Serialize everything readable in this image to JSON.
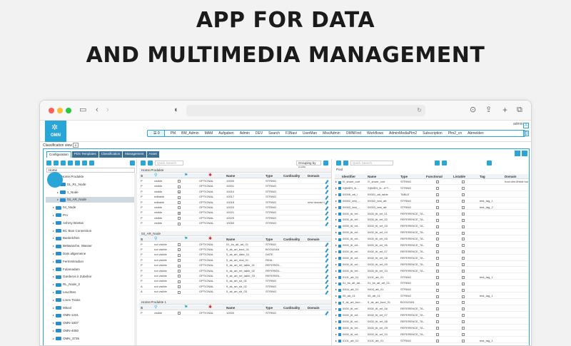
{
  "headline": {
    "line1": "APP FOR DATA",
    "line2": "AND MULTIMEDIA MANAGEMENT"
  },
  "app": {
    "logo": "OMN",
    "menu": [
      "PM",
      "BM_Admin",
      "MAM",
      "Aufgaben",
      "Admin",
      "DEV",
      "Search",
      "F3Navi",
      "UserMan",
      "MiscAdmin",
      "OMNFind",
      "Workflows",
      "AdminMediaPlm2",
      "Subscription",
      "Plm2_cn",
      "Abmelden"
    ],
    "user": "admin",
    "window_label": "Classification view",
    "module_tabs": [
      "Configuration",
      "PDS Templates",
      "Classification",
      "Management",
      "Asset"
    ],
    "active_tab": 0
  },
  "left": {
    "search_value": "Home",
    "tree": [
      "Home.Produkte",
      "01_RL_Node",
      "1_Node",
      "03_AR_Node",
      "04_Node",
      "Pro",
      "Ashrsy Brietas",
      "BC Bios Connection",
      "Bankelchen",
      "Bettwasche, Wasser",
      "Dats allgemeine",
      "Fermmitradion",
      "Fulamadam",
      "Garderos ir Zubehor",
      "RL_Node_2",
      "Leuchtes",
      "Lmes Trains",
      "Mitool",
      "OMN-1241",
      "OMN-1837",
      "OMN-4050",
      "OMN_3735"
    ]
  },
  "middle": {
    "search_placeholder": "Quick Search",
    "grouping": "Grouping by node",
    "section1": "Home.Produkte",
    "section2": "03_AR_Node",
    "section3": "Home.Produkte 1",
    "columns": [
      "S",
      "",
      "",
      "",
      "Name",
      "Type",
      "Cardinality",
      "Domain"
    ],
    "rows1": [
      [
        "P",
        "visible",
        "0",
        "OPTIONAL",
        "10000",
        "STRING",
        ""
      ],
      [
        "P",
        "visible",
        "0",
        "OPTIONAL",
        "10001",
        "STRING",
        ""
      ],
      [
        "P",
        "visible",
        "1",
        "OPTIONAL",
        "10010",
        "STRING",
        ""
      ],
      [
        "P",
        "editable",
        "0",
        "OPTIONAL",
        "10017",
        "STRING",
        ""
      ],
      [
        "P",
        "editable",
        "0",
        "OPTIONAL",
        "10018",
        "STRING",
        "new domain v..."
      ],
      [
        "P",
        "visible",
        "0",
        "OPTIONAL",
        "10020",
        "STRING",
        ""
      ],
      [
        "P",
        "visible",
        "1",
        "OPTIONAL",
        "10021",
        "STRING",
        ""
      ],
      [
        "P",
        "visible",
        "0",
        "OPTIONAL",
        "10029",
        "STRING",
        ""
      ],
      [
        "P",
        "visible",
        "0",
        "OPTIONAL",
        "10050",
        "STRING",
        ""
      ]
    ],
    "rows2": [
      [
        "P",
        "not visible",
        "0",
        "OPTIONAL",
        "01_bs_alt_art_01",
        "STRING"
      ],
      [
        "P",
        "not visible",
        "0",
        "OPTIONAL",
        "5_ak_art_bool_01",
        "BOOLEAN"
      ],
      [
        "P",
        "not visible",
        "0",
        "OPTIONAL",
        "5_ak_art_date_01",
        "DATE"
      ],
      [
        "P",
        "not visible",
        "0",
        "OPTIONAL",
        "5_ak_art_real_01",
        "REAL"
      ],
      [
        "P",
        "not visible",
        "0",
        "OPTIONAL",
        "5_ak_art_ref_table_01",
        "REFEREN..."
      ],
      [
        "P",
        "not visible",
        "0",
        "OPTIONAL",
        "5_ak_art_ref_table_02",
        "REFEREN..."
      ],
      [
        "P",
        "not visible",
        "0",
        "OPTIONAL",
        "5_ak_art_ref_table_03",
        "REFEREN..."
      ],
      [
        "P",
        "not visible",
        "0",
        "OPTIONAL",
        "5_ak_art_str_01",
        "STRING"
      ],
      [
        "A",
        "not visible",
        "0",
        "OPTIONAL",
        "5_ak_art_str_02",
        "STRING"
      ],
      [
        "A",
        "not visible",
        "0",
        "OPTIONAL",
        "5_ak_art_str_03",
        "STRING"
      ]
    ],
    "rows3": [
      [
        "P",
        "visible",
        "0",
        "OPTIONAL",
        "10000",
        "STRING"
      ]
    ]
  },
  "right": {
    "search_placeholder": "Quick Search",
    "pool_label": "Pool",
    "columns": [
      "Identifier",
      "Name",
      "Type",
      "Functional",
      "Listable",
      "Tag",
      "Domain"
    ],
    "rows": [
      [
        "!!!_shum_cort",
        "!!!_shum_cort",
        "STRING",
        "",
        "",
        "",
        "hoci:dmr.8htrdr.hoi"
      ],
      [
        "!!@#$%_ik...",
        "!!@#$%_ik...#^*!...",
        "STRING",
        "",
        "",
        "",
        ""
      ],
      [
        "00006_att_l",
        "00001_att_table",
        "TABLE",
        "",
        "",
        "",
        ""
      ],
      [
        "00002_test_...",
        "00002_test_att",
        "STRING",
        "",
        "",
        "test_tag_1",
        ""
      ],
      [
        "00003_test_...",
        "00003_test_att",
        "STRING",
        "",
        "",
        "test_tag_2",
        ""
      ],
      [
        "0000_ttl_ref...",
        "0000_ttl_ref_01",
        "REFERENCE_TA...",
        "",
        "",
        "",
        ""
      ],
      [
        "0000_ttl_ref...",
        "0000_ttl_ref_02",
        "REFERENCE_TA...",
        "",
        "",
        "",
        ""
      ],
      [
        "0000_ttl_ref...",
        "0000_ttl_ref_03",
        "REFERENCE_TA...",
        "",
        "",
        "",
        ""
      ],
      [
        "0000_ttl_ref...",
        "0000_ttl_ref_04",
        "REFERENCE_TA...",
        "",
        "",
        "",
        ""
      ],
      [
        "0000_ttl_ref...",
        "0000_ttl_ref_05",
        "REFERENCE_TA...",
        "",
        "",
        "",
        ""
      ],
      [
        "0000_ttl_ref...",
        "0000_ttl_ref_06",
        "REFERENCE_TA...",
        "",
        "",
        "",
        ""
      ],
      [
        "0000_ttl_ref...",
        "0000_ttl_ref_07",
        "REFERENCE_TA...",
        "",
        "",
        "",
        ""
      ],
      [
        "0000_ttl_ref...",
        "0000_ttl_ref_08",
        "REFERENCE_TA...",
        "",
        "",
        "",
        ""
      ],
      [
        "0000_ttl_ref...",
        "0000_ttl_ref_09",
        "REFERENCE_TA...",
        "",
        "",
        "",
        ""
      ],
      [
        "0000_ttl_ref...",
        "0000_ttl_ref_10",
        "REFERENCE_TA...",
        "",
        "",
        "",
        ""
      ],
      [
        "0101_att_01",
        "0101_att_01",
        "STRING",
        "",
        "",
        "test_tag_1",
        ""
      ],
      [
        "01_bs_alt_art...",
        "01_bs_alt_art_01",
        "STRING",
        "",
        "",
        "",
        ""
      ],
      [
        "0404_att_01",
        "0404_att_01",
        "STRING",
        "",
        "",
        "",
        ""
      ],
      [
        "05_att_01",
        "05_att_01",
        "STRING",
        "",
        "",
        "test_tag_1",
        ""
      ],
      [
        "5_ak_art_boo...",
        "5_ak_art_bool_01",
        "BOOLEAN",
        "",
        "",
        "",
        ""
      ],
      [
        "0000_ttl_ref...",
        "0000_ttl_ref_06",
        "REFERENCE_TA...",
        "",
        "",
        "",
        ""
      ],
      [
        "0000_ttl_ref...",
        "0000_ttl_ref_07",
        "REFERENCE_TA...",
        "",
        "",
        "",
        ""
      ],
      [
        "0000_ttl_ref...",
        "0000_ttl_ref_08",
        "REFERENCE_TA...",
        "",
        "",
        "",
        ""
      ],
      [
        "0000_ttl_ref...",
        "0000_ttl_ref_09",
        "REFERENCE_TA...",
        "",
        "",
        "",
        ""
      ],
      [
        "0000_ttl_ref...",
        "0000_ttl_ref_10",
        "REFERENCE_TA...",
        "",
        "",
        "",
        ""
      ],
      [
        "0101_att_01",
        "0101_att_01",
        "STRING",
        "",
        "",
        "test_tag_1",
        ""
      ]
    ]
  },
  "colors": {
    "accent": "#2aa5d8",
    "dark_tab": "#3b6f93",
    "folder": "#2a8fc9"
  }
}
